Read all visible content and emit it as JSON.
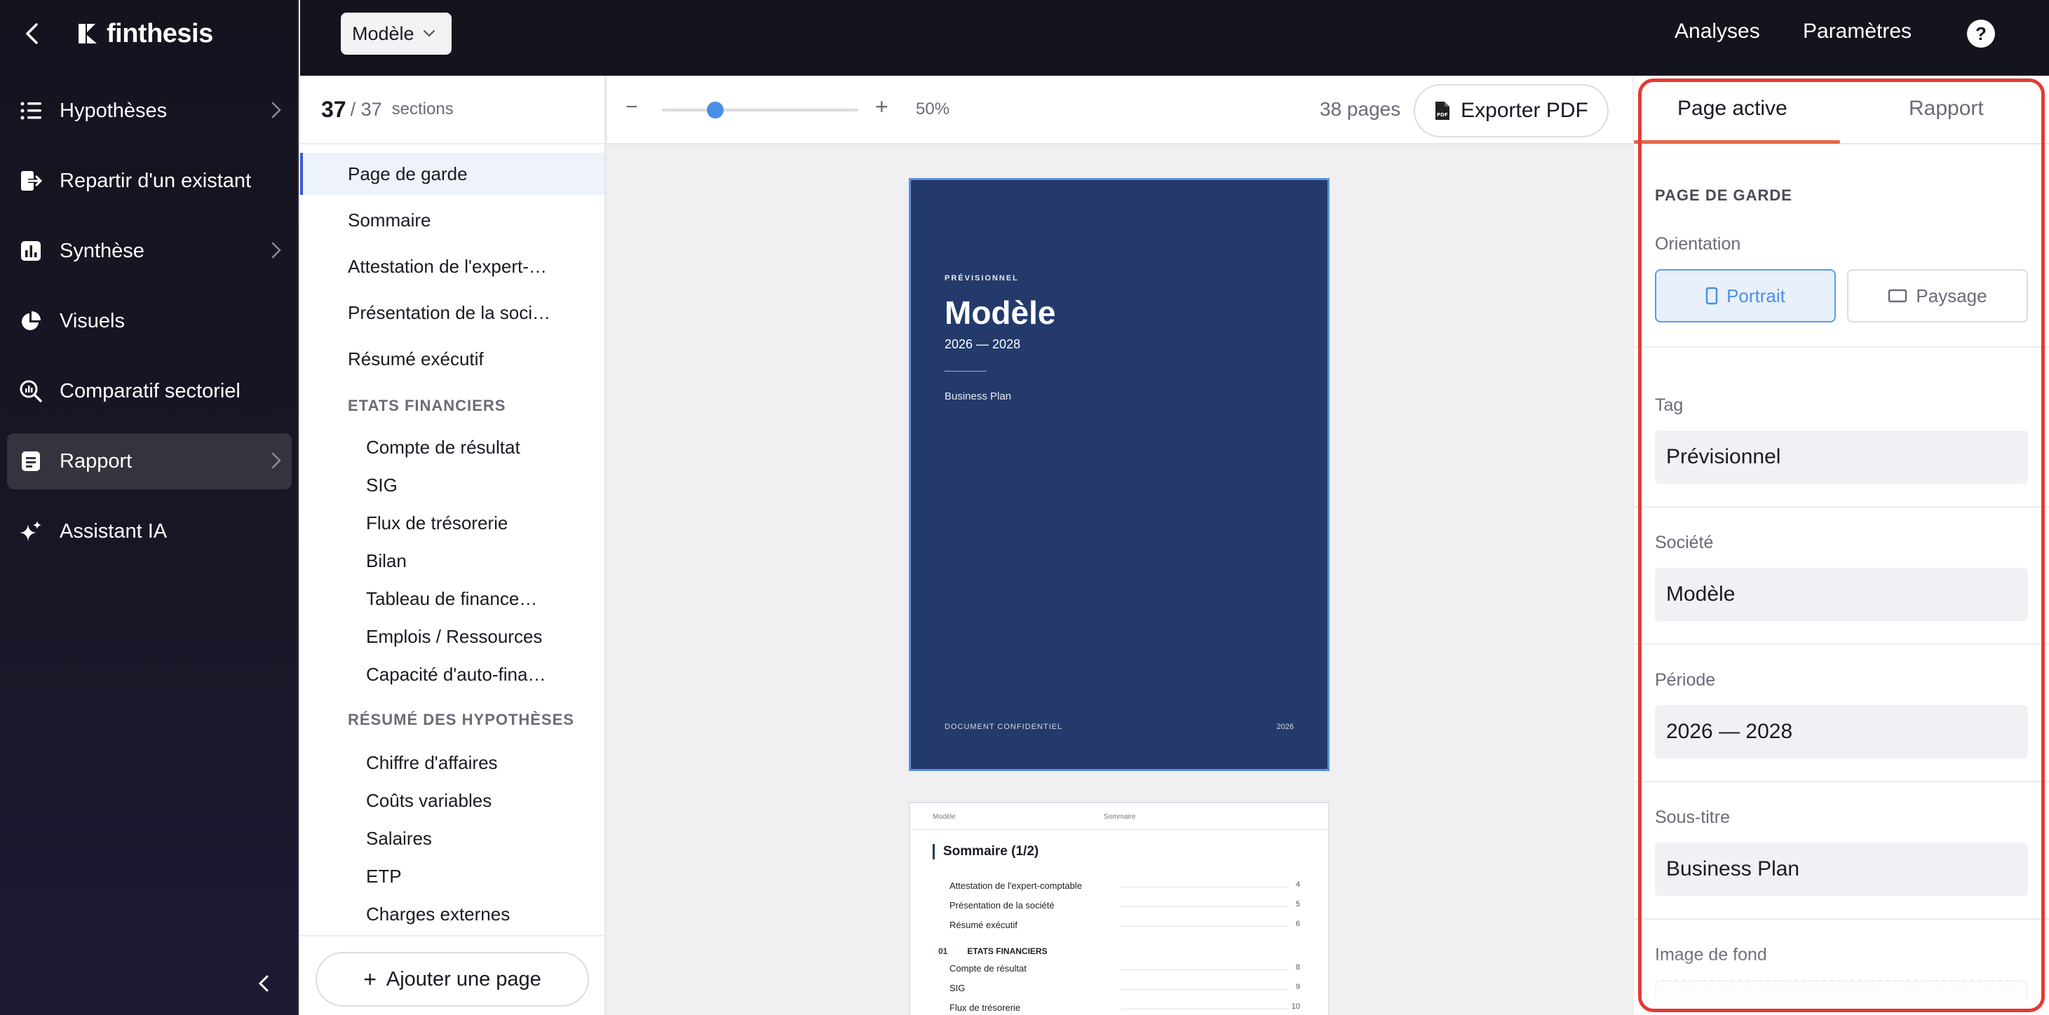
{
  "app": {
    "logo_text": "finthesis"
  },
  "sidebar": {
    "items": [
      {
        "label": "Hypothèses",
        "icon": "list-icon",
        "has_chevron": true
      },
      {
        "label": "Repartir d'un existant",
        "icon": "import-icon",
        "has_chevron": false
      },
      {
        "label": "Synthèse",
        "icon": "bar-chart-icon",
        "has_chevron": true
      },
      {
        "label": "Visuels",
        "icon": "pie-chart-icon",
        "has_chevron": false
      },
      {
        "label": "Comparatif sectoriel",
        "icon": "search-chart-icon",
        "has_chevron": false
      },
      {
        "label": "Rapport",
        "icon": "document-icon",
        "has_chevron": true,
        "active": true
      },
      {
        "label": "Assistant IA",
        "icon": "sparkle-icon",
        "has_chevron": false
      }
    ]
  },
  "topbar": {
    "model_select": "Modèle",
    "links": [
      "Analyses",
      "Paramètres"
    ],
    "help": "?"
  },
  "sections_panel": {
    "count": "37",
    "total": "/ 37",
    "label": "sections",
    "items": [
      {
        "label": "Page de garde",
        "type": "item",
        "active": true
      },
      {
        "label": "Sommaire",
        "type": "item"
      },
      {
        "label": "Attestation de l'expert-…",
        "type": "item"
      },
      {
        "label": "Présentation de la soci…",
        "type": "item"
      },
      {
        "label": "Résumé exécutif",
        "type": "item"
      },
      {
        "label": "ETATS FINANCIERS",
        "type": "group"
      },
      {
        "label": "Compte de résultat",
        "type": "sub"
      },
      {
        "label": "SIG",
        "type": "sub"
      },
      {
        "label": "Flux de trésorerie",
        "type": "sub"
      },
      {
        "label": "Bilan",
        "type": "sub"
      },
      {
        "label": "Tableau de finance…",
        "type": "sub"
      },
      {
        "label": "Emplois / Ressources",
        "type": "sub"
      },
      {
        "label": "Capacité d'auto-fina…",
        "type": "sub"
      },
      {
        "label": "RÉSUMÉ DES HYPOTHÈSES",
        "type": "group"
      },
      {
        "label": "Chiffre d'affaires",
        "type": "sub"
      },
      {
        "label": "Coûts variables",
        "type": "sub"
      },
      {
        "label": "Salaires",
        "type": "sub"
      },
      {
        "label": "ETP",
        "type": "sub"
      },
      {
        "label": "Charges externes",
        "type": "sub"
      }
    ],
    "add_page": "Ajouter une page"
  },
  "preview": {
    "zoom": "50%",
    "zoom_level": 0.5,
    "zoom_minus": "−",
    "zoom_plus": "+",
    "pages": "38 pages",
    "export": "Exporter PDF",
    "cover": {
      "tag": "PRÉVISIONNEL",
      "title": "Modèle",
      "period": "2026 — 2028",
      "subtitle": "Business Plan",
      "footer": "DOCUMENT CONFIDENTIEL",
      "year": "2026",
      "bg_color": "#233a6b"
    },
    "toc": {
      "header_left": "Modèle",
      "header_right": "Sommaire",
      "title": "Sommaire (1/2)",
      "rows": [
        {
          "label": "Attestation de l'expert-comptable",
          "page": "4"
        },
        {
          "label": "Présentation de la société",
          "page": "5"
        },
        {
          "label": "Résumé exécutif",
          "page": "6"
        }
      ],
      "section": {
        "num": "01",
        "label": "ETATS FINANCIERS"
      },
      "sub_rows": [
        {
          "label": "Compte de résultat",
          "page": "8"
        },
        {
          "label": "SIG",
          "page": "9"
        },
        {
          "label": "Flux de trésorerie",
          "page": "10"
        }
      ]
    }
  },
  "right_panel": {
    "tabs": [
      "Page active",
      "Rapport"
    ],
    "heading": "PAGE DE GARDE",
    "orientation_label": "Orientation",
    "portrait": "Portrait",
    "paysage": "Paysage",
    "tag_label": "Tag",
    "tag_value": "Prévisionnel",
    "societe_label": "Société",
    "societe_value": "Modèle",
    "periode_label": "Période",
    "periode_value": "2026 — 2028",
    "soustitre_label": "Sous-titre",
    "soustitre_value": "Business Plan",
    "image_label": "Image de fond"
  },
  "colors": {
    "accent": "#4b8fe8",
    "tab_underline": "#e8644a",
    "highlight_frame": "#e53935",
    "sidebar_bg": "#14141f"
  }
}
